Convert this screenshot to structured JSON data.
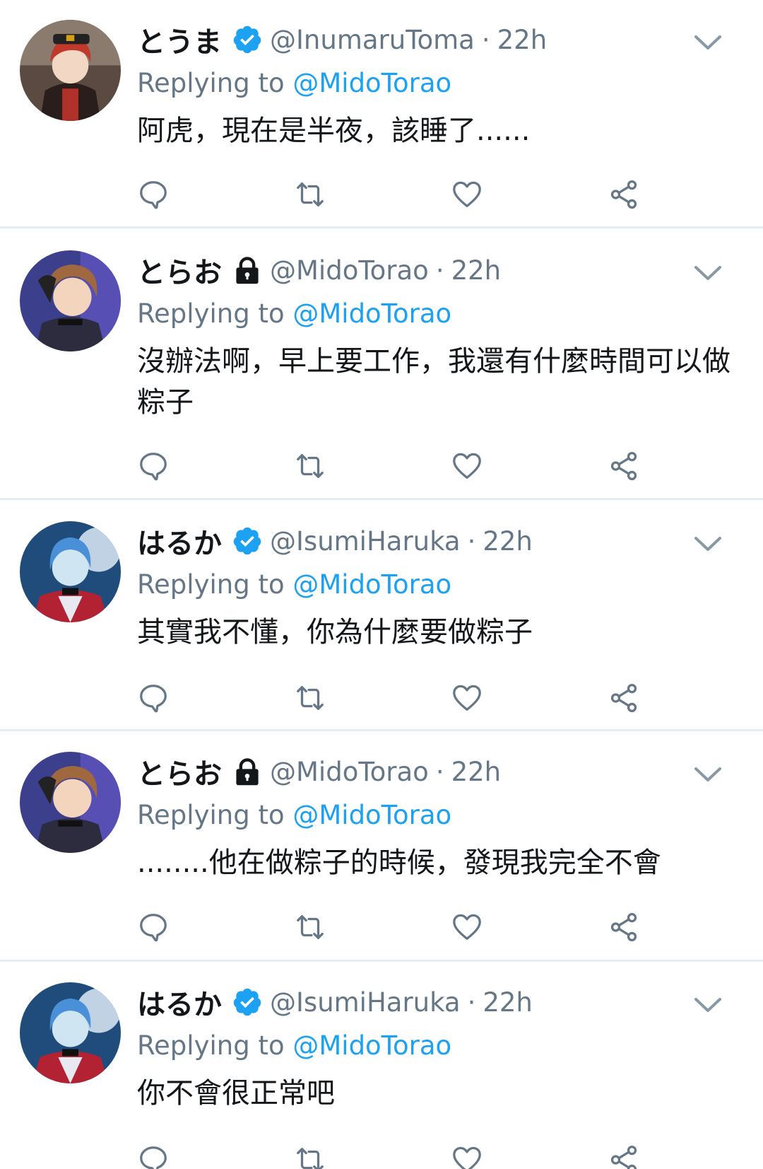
{
  "replying_prefix": "Replying to ",
  "colors": {
    "accent": "#1da1f2",
    "secondary_text": "#657786",
    "primary_text": "#14171a",
    "divider": "#e6ecf0"
  },
  "tweets": [
    {
      "display_name": "とうま",
      "badge": "verified-icon",
      "handle": "@InumaruToma",
      "separator": "·",
      "time": "22h",
      "reply_to": "@MidoTorao",
      "text": "阿虎，現在是半夜，該睡了......",
      "avatar": "toma-avatar"
    },
    {
      "display_name": "とらお",
      "badge": "lock-icon",
      "handle": "@MidoTorao",
      "separator": "·",
      "time": "22h",
      "reply_to": "@MidoTorao",
      "text": "沒辦法啊，早上要工作，我還有什麼時間可以做粽子",
      "avatar": "torao-avatar"
    },
    {
      "display_name": "はるか",
      "badge": "verified-icon",
      "handle": "@IsumiHaruka",
      "separator": "·",
      "time": "22h",
      "reply_to": "@MidoTorao",
      "text": "其實我不懂，你為什麼要做粽子",
      "avatar": "haruka-avatar"
    },
    {
      "display_name": "とらお",
      "badge": "lock-icon",
      "handle": "@MidoTorao",
      "separator": "·",
      "time": "22h",
      "reply_to": "@MidoTorao",
      "text": "........他在做粽子的時候，發現我完全不會",
      "avatar": "torao-avatar"
    },
    {
      "display_name": "はるか",
      "badge": "verified-icon",
      "handle": "@IsumiHaruka",
      "separator": "·",
      "time": "22h",
      "reply_to": "@MidoTorao",
      "text": "你不會很正常吧",
      "avatar": "haruka-avatar"
    }
  ]
}
